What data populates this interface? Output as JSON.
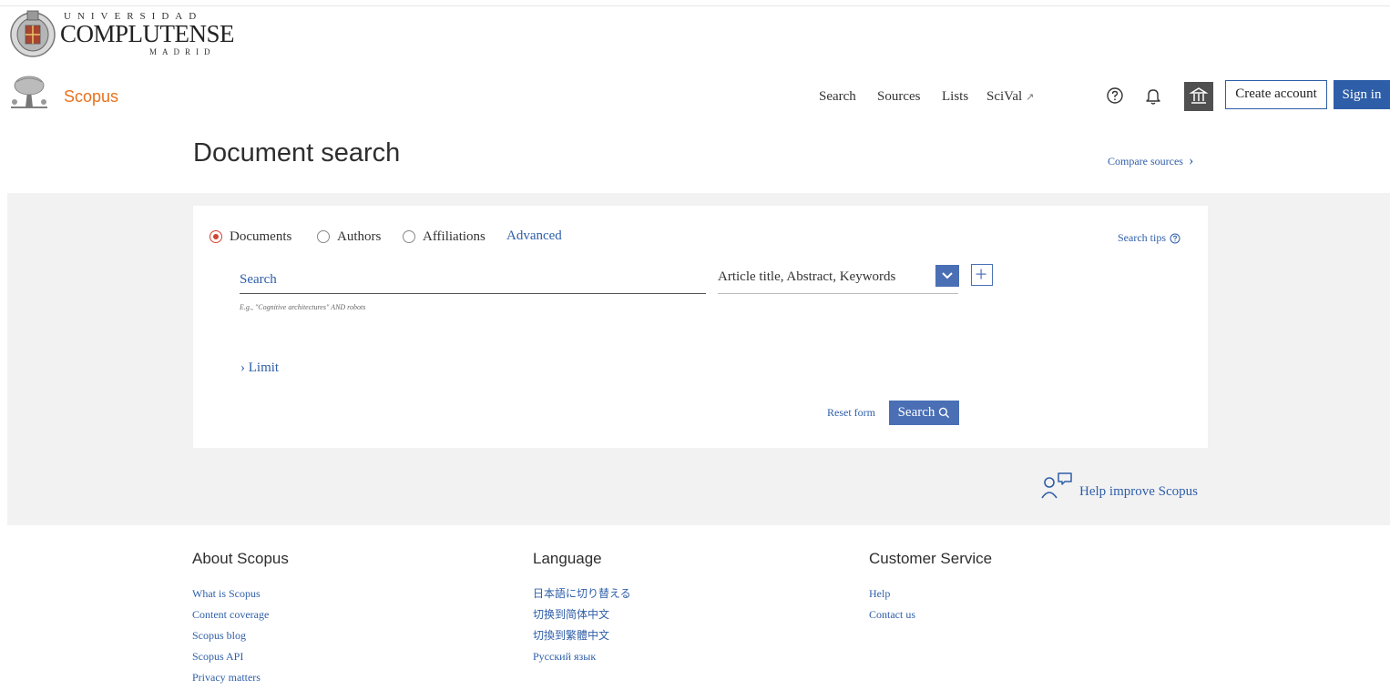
{
  "university": {
    "line1": "UNIVERSIDAD",
    "line2": "COMPLUTENSE",
    "line3": "MADRID"
  },
  "header": {
    "brand": "Scopus",
    "nav": {
      "search": "Search",
      "sources": "Sources",
      "lists": "Lists",
      "scival": "SciVal",
      "scival_ext": "↗"
    },
    "create_account": "Create account",
    "sign_in": "Sign in",
    "icons": [
      "help-icon",
      "bell-icon",
      "institution-icon"
    ]
  },
  "main": {
    "title": "Document search",
    "compare_sources": "Compare sources",
    "tabs": [
      {
        "label": "Documents",
        "selected": true
      },
      {
        "label": "Authors",
        "selected": false
      },
      {
        "label": "Affiliations",
        "selected": false
      }
    ],
    "advanced": "Advanced",
    "search_tips": "Search tips",
    "search": {
      "placeholder": "Search",
      "value": "",
      "hint": "E.g., \"Cognitive architectures\" AND robots"
    },
    "field": {
      "selected": "Article title, Abstract, Keywords"
    },
    "limit": "Limit",
    "reset": "Reset form",
    "submit": "Search",
    "help_improve": "Help improve Scopus"
  },
  "footer": {
    "about": {
      "heading": "About Scopus",
      "links": [
        "What is Scopus",
        "Content coverage",
        "Scopus blog",
        "Scopus API",
        "Privacy matters"
      ]
    },
    "language": {
      "heading": "Language",
      "links": [
        "日本語に切り替える",
        "切换到简体中文",
        "切換到繁體中文",
        "Русский язык"
      ]
    },
    "customer": {
      "heading": "Customer Service",
      "links": [
        "Help",
        "Contact us"
      ]
    }
  },
  "colors": {
    "brand_orange": "#e9711c",
    "link_blue": "#2e5ea8",
    "button_blue": "#4a6fb5",
    "radio_selected": "#d04532",
    "band_grey": "#f2f2f2"
  }
}
